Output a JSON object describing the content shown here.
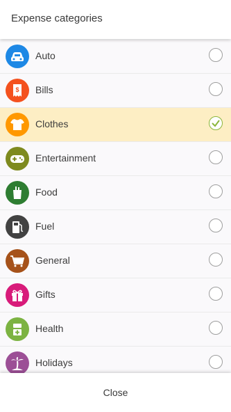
{
  "header": {
    "title": "Expense categories"
  },
  "categories": [
    {
      "label": "Auto",
      "icon": "car-icon",
      "color": "#1e88e5",
      "selected": false
    },
    {
      "label": "Bills",
      "icon": "receipt-icon",
      "color": "#f4511e",
      "selected": false
    },
    {
      "label": "Clothes",
      "icon": "shirt-icon",
      "color": "#ff9800",
      "selected": true
    },
    {
      "label": "Entertainment",
      "icon": "gamepad-icon",
      "color": "#7e8a1f",
      "selected": false
    },
    {
      "label": "Food",
      "icon": "grocery-bag-icon",
      "color": "#2e7d32",
      "selected": false
    },
    {
      "label": "Fuel",
      "icon": "fuel-pump-icon",
      "color": "#424242",
      "selected": false
    },
    {
      "label": "General",
      "icon": "shopping-cart-icon",
      "color": "#a6521a",
      "selected": false
    },
    {
      "label": "Gifts",
      "icon": "gift-icon",
      "color": "#d81b7a",
      "selected": false
    },
    {
      "label": "Health",
      "icon": "medical-icon",
      "color": "#7cb342",
      "selected": false
    },
    {
      "label": "Holidays",
      "icon": "palm-tree-icon",
      "color": "#9c4f96",
      "selected": false
    }
  ],
  "footer": {
    "close_label": "Close"
  }
}
